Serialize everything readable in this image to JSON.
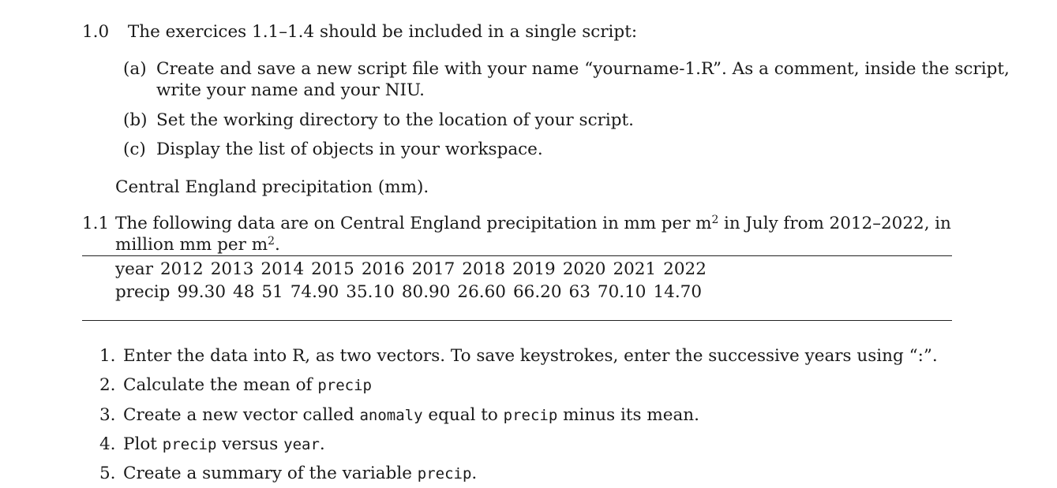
{
  "header": {
    "number": "1.0",
    "text": "The exercices 1.1–1.4 should be included in a single script:"
  },
  "setup_items": [
    {
      "label": "(a)",
      "line1": "Create and save a new script file with your name “yourname-1.R”. As a comment, inside the script,",
      "line2": "write your name and your NIU."
    },
    {
      "label": "(b)",
      "line1": "Set the working directory to the location of your script."
    },
    {
      "label": "(c)",
      "line1": "Display the list of objects in your workspace."
    }
  ],
  "caption": "Central England precipitation (mm).",
  "exercise": {
    "number": "1.1",
    "line1_words": [
      "The",
      "following",
      "data",
      "are",
      "on",
      "Central",
      "England",
      "precipitation",
      "in",
      "mm",
      "per",
      "m²",
      "in",
      "July",
      "from",
      "2012–2022,",
      "in"
    ],
    "line2_prefix": "million mm per m",
    "line2_sup": "2",
    "line2_suffix": "."
  },
  "table": {
    "year_label": "year",
    "years": [
      "2012",
      "2013",
      "2014",
      "2015",
      "2016",
      "2017",
      "2018",
      "2019",
      "2020",
      "2021",
      "2022"
    ],
    "precip_label": "precip",
    "precip": [
      "99.30",
      "48",
      "51",
      "74.90",
      "35.10",
      "80.90",
      "26.60",
      "66.20",
      "63",
      "70.10",
      "14.70"
    ]
  },
  "tasks": [
    {
      "num": "1.",
      "parts": [
        {
          "t": "Enter the data into R, as two vectors. To save keystrokes, enter the successive years using “:”.",
          "code": false
        }
      ]
    },
    {
      "num": "2.",
      "parts": [
        {
          "t": "Calculate the mean of ",
          "code": false
        },
        {
          "t": "precip",
          "code": true
        }
      ]
    },
    {
      "num": "3.",
      "parts": [
        {
          "t": "Create a new vector called ",
          "code": false
        },
        {
          "t": "anomaly",
          "code": true
        },
        {
          "t": " equal to ",
          "code": false
        },
        {
          "t": "precip",
          "code": true
        },
        {
          "t": " minus its mean.",
          "code": false
        }
      ]
    },
    {
      "num": "4.",
      "parts": [
        {
          "t": "Plot ",
          "code": false
        },
        {
          "t": "precip",
          "code": true
        },
        {
          "t": " versus ",
          "code": false
        },
        {
          "t": "year",
          "code": true
        },
        {
          "t": ".",
          "code": false
        }
      ]
    },
    {
      "num": "5.",
      "parts": [
        {
          "t": "Create a summary of the variable ",
          "code": false
        },
        {
          "t": "precip",
          "code": true
        },
        {
          "t": ".",
          "code": false
        }
      ]
    }
  ]
}
